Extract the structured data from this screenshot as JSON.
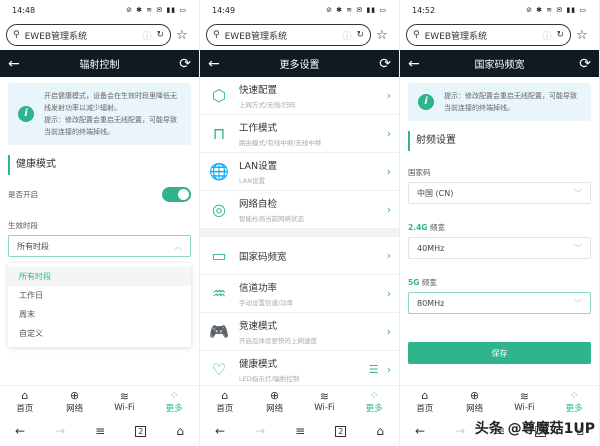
{
  "common": {
    "url_title": "EWEB管理系统",
    "tabs": [
      "首页",
      "网络",
      "Wi-Fi",
      "更多"
    ]
  },
  "panels": [
    {
      "time": "14:48",
      "title": "辐射控制"
    },
    {
      "time": "14:49",
      "title": "更多设置"
    },
    {
      "time": "14:52",
      "title": "国家码频宽"
    }
  ],
  "radiation": {
    "info": [
      "开启健康模式，设备会在生效时段里降低无线发射功率以减少辐射。",
      "提示：修改配置会重启无线配置，可能导致当前连接的终端掉线。"
    ],
    "section": "健康模式",
    "enable_label": "是否开启",
    "enabled": true,
    "period_label": "生效时段",
    "period_value": "所有时段",
    "options": [
      "所有时段",
      "工作日",
      "周末",
      "自定义"
    ]
  },
  "more": {
    "items": [
      {
        "title": "快速配置",
        "sub": "上网方式/无线/扫码",
        "icon": "lightning-icon"
      },
      {
        "title": "工作模式",
        "sub": "路由模式/有线中继/无线中继",
        "icon": "work-mode-icon"
      },
      {
        "title": "LAN设置",
        "sub": "LAN设置",
        "icon": "globe-icon"
      },
      {
        "title": "网络自检",
        "sub": "智能检测当前网络状态",
        "icon": "network-check-icon"
      },
      {
        "title": "国家码频宽",
        "sub": "",
        "icon": "monitor-icon"
      },
      {
        "title": "信道功率",
        "sub": "手动设置信道/功率",
        "icon": "pulse-icon"
      },
      {
        "title": "竞速模式",
        "sub": "开启后体验更快的上网速度",
        "icon": "gamepad-icon"
      },
      {
        "title": "健康模式",
        "sub": "LED指示灯/辐射控制",
        "icon": "heart-icon"
      }
    ]
  },
  "country": {
    "info": "提示：修改配置会重启无线配置，可能导致当前连接的终端掉线。",
    "section": "射频设置",
    "country_label": "国家码",
    "country_value": "中国 (CN)",
    "band24_prefix": "2.4G",
    "band24_label": "频宽",
    "band24_value": "40MHz",
    "band5_prefix": "5G",
    "band5_label": "频宽",
    "band5_value": "80MHz",
    "save": "保存"
  },
  "watermark": "头条 @尊魔菇1UP",
  "colors": {
    "accent": "#2fb48e",
    "header": "#0f1a22"
  }
}
